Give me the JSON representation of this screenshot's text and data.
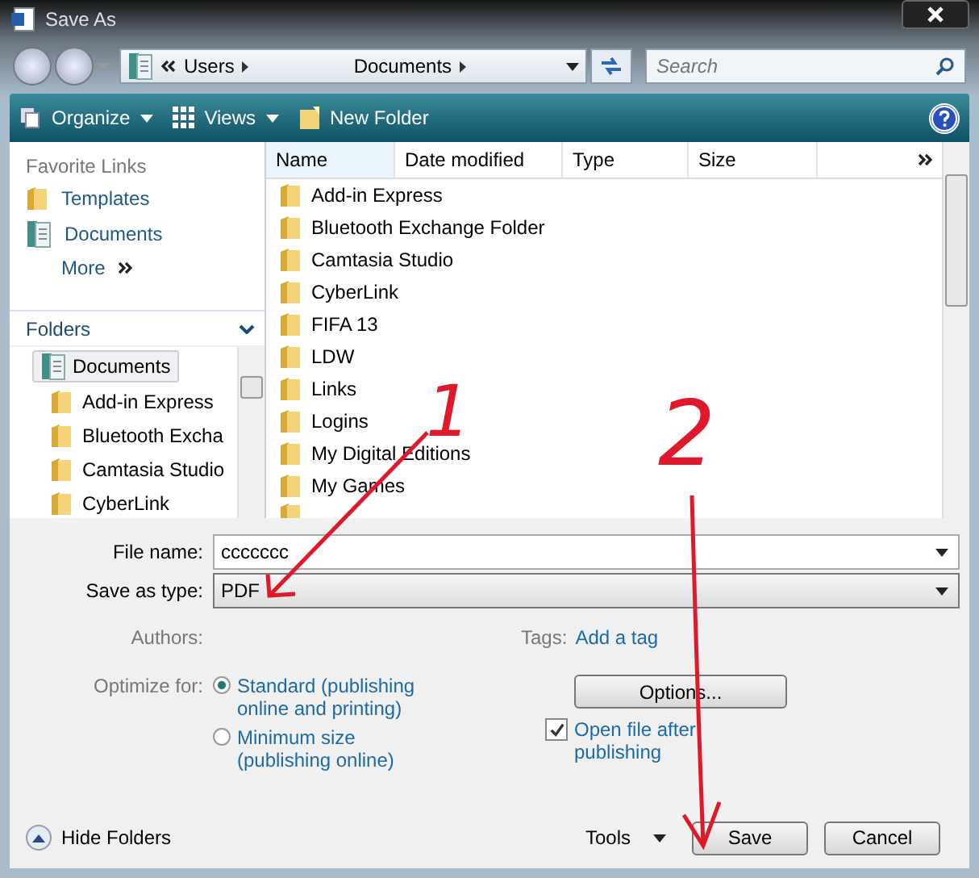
{
  "window": {
    "title": "Save As"
  },
  "address": {
    "segments": [
      "Users",
      "Documents"
    ],
    "search_placeholder": "Search"
  },
  "toolbar": [
    {
      "label": "Organize",
      "kind": "organize"
    },
    {
      "label": "Views",
      "kind": "views"
    },
    {
      "label": "New Folder",
      "kind": "newfolder"
    }
  ],
  "favorite_links": {
    "title": "Favorite Links",
    "items": [
      {
        "label": "Templates",
        "kind": "folder"
      },
      {
        "label": "Documents",
        "kind": "docs"
      },
      {
        "label": "More",
        "kind": "more"
      }
    ]
  },
  "folders": {
    "title": "Folders",
    "tree": [
      {
        "label": "Documents",
        "selected": true,
        "children": [
          {
            "label": "Add-in Express",
            "selected": false
          },
          {
            "label": "Bluetooth Excha",
            "selected": false
          },
          {
            "label": "Camtasia Studio",
            "selected": false
          },
          {
            "label": "CyberLink",
            "selected": false
          }
        ]
      }
    ]
  },
  "file_list": {
    "columns": [
      "Name",
      "Date modified",
      "Type",
      "Size"
    ],
    "rows": [
      "Add-in Express",
      "Bluetooth Exchange Folder",
      "Camtasia Studio",
      "CyberLink",
      "FIFA 13",
      "LDW",
      "Links",
      "Logins",
      "My Digital Editions",
      "My Games"
    ]
  },
  "form": {
    "file_name_label": "File name:",
    "file_name": "ccccccc",
    "type_label": "Save as type:",
    "save_as_type": "PDF",
    "authors_label": "Authors:",
    "tags_label": "Tags:",
    "tags_link": "Add a tag",
    "optimize_label": "Optimize for:",
    "optimize_options": [
      {
        "label": "Standard (publishing online and printing)",
        "selected": true
      },
      {
        "label": "Minimum size (publishing online)",
        "selected": false
      }
    ],
    "options_button": "Options...",
    "open_after": {
      "label": "Open file after publishing",
      "checked": true
    }
  },
  "footer": {
    "hide_folders": "Hide Folders",
    "tools": "Tools",
    "buttons": [
      "Save",
      "Cancel"
    ]
  },
  "annotations": [
    {
      "label": "1"
    },
    {
      "label": "2"
    }
  ]
}
